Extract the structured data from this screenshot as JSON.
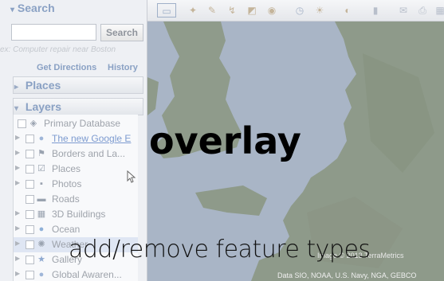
{
  "search": {
    "header": "Search",
    "button_label": "Search",
    "hint": "ex: Computer repair near Boston",
    "get_directions": "Get Directions",
    "history": "History"
  },
  "places": {
    "header": "Places"
  },
  "layers": {
    "header": "Layers",
    "items": [
      {
        "label": "Primary Database",
        "icon": "layers-stack-icon"
      },
      {
        "label": "The new Google E",
        "icon": "globe-icon",
        "link": true
      },
      {
        "label": "Borders and La...",
        "icon": "flag-icon"
      },
      {
        "label": "Places",
        "icon": "pin-icon"
      },
      {
        "label": "Photos",
        "icon": "photo-icon"
      },
      {
        "label": "Roads",
        "icon": "road-icon"
      },
      {
        "label": "3D Buildings",
        "icon": "building-icon"
      },
      {
        "label": "Ocean",
        "icon": "ocean-icon"
      },
      {
        "label": "Weather",
        "icon": "weather-icon"
      },
      {
        "label": "Gallery",
        "icon": "star-icon"
      },
      {
        "label": "Global Awaren...",
        "icon": "globe-awareness-icon"
      }
    ]
  },
  "overlay": {
    "title": "overlay",
    "caption": "add/remove feature types"
  },
  "map": {
    "attribution_image": "Image © 2013 TerraMetrics",
    "attribution_data": "Data SIO, NOAA, U.S. Navy, NGA, GEBCO"
  },
  "colors": {
    "map_water": "#a9b5c6",
    "map_land": "#8e9a8a",
    "accent_blue": "#8aa1c4"
  }
}
